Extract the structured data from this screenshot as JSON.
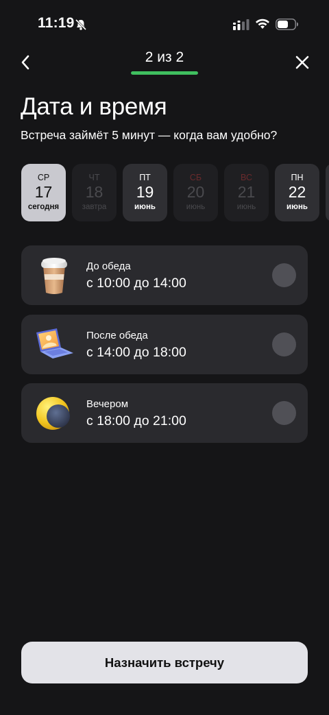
{
  "status_bar": {
    "time": "11:19"
  },
  "header": {
    "step_label": "2 из 2",
    "progress": 1.0,
    "progress_color": "#3fbf5f"
  },
  "title": "Дата и время",
  "subtitle": "Встреча займёт 5 минут — когда вам удобно?",
  "dates": [
    {
      "dow": "СР",
      "day": "17",
      "sub": "сегодня",
      "state": "selected"
    },
    {
      "dow": "ЧТ",
      "day": "18",
      "sub": "завтра",
      "state": "disabled"
    },
    {
      "dow": "ПТ",
      "day": "19",
      "sub": "июнь",
      "state": "available"
    },
    {
      "dow": "СБ",
      "day": "20",
      "sub": "июнь",
      "state": "disabled-weekend"
    },
    {
      "dow": "ВС",
      "day": "21",
      "sub": "июнь",
      "state": "disabled-weekend"
    },
    {
      "dow": "ПН",
      "day": "22",
      "sub": "июнь",
      "state": "available"
    }
  ],
  "slots": [
    {
      "label": "До обеда",
      "time": "с 10:00 до 14:00",
      "icon": "coffee-cup-icon"
    },
    {
      "label": "После обеда",
      "time": "с 14:00 до 18:00",
      "icon": "laptop-icon"
    },
    {
      "label": "Вечером",
      "time": "с 18:00 до 21:00",
      "icon": "moon-icon"
    }
  ],
  "primary_button": "Назначить встречу"
}
